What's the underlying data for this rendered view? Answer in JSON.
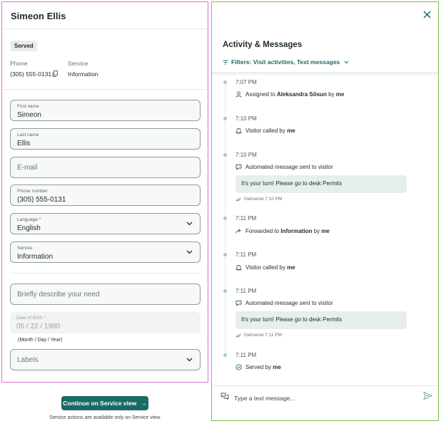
{
  "visitor": {
    "name": "Simeon Ellis",
    "status_badge": "Served",
    "phone_label": "Phone",
    "phone_value": "(305) 555-0131",
    "service_label": "Service",
    "service_value": "Information"
  },
  "form": {
    "first_name": {
      "label": "First name",
      "value": "Simeon"
    },
    "last_name": {
      "label": "Last name",
      "value": "Ellis"
    },
    "email": {
      "placeholder": "E-mail"
    },
    "phone": {
      "label": "Phone number",
      "value": "(305) 555-0131"
    },
    "language": {
      "label": "Language *",
      "value": "English"
    },
    "service": {
      "label": "Service",
      "value": "Information"
    },
    "need": {
      "placeholder": "Briefly describe your need"
    },
    "dob": {
      "label": "Date of Birth *",
      "placeholder": "05 / 22 / 1980",
      "hint": "(Month / Day / Year)"
    },
    "labels": {
      "placeholder": "Labels"
    }
  },
  "footer": {
    "continue_label": "Continue on Service view",
    "continue_arrow": "→",
    "note": "Service actions are available only on Service view."
  },
  "activity": {
    "title": "Activity & Messages",
    "filters_label": "Filters: Visit activities, Text messages",
    "events": [
      {
        "time": "7:07 PM",
        "icon": "user-icon",
        "pre": "Assigned to ",
        "bold": "Aleksandra Sõsun",
        "post": " by ",
        "by": "me"
      },
      {
        "time": "7:10 PM",
        "icon": "bell-icon",
        "pre": "Visitor called by ",
        "bold": "",
        "post": "",
        "by": "me"
      },
      {
        "time": "7:10 PM",
        "icon": "message-icon",
        "pre": "Automated message sent to visitor",
        "bold": "",
        "post": "",
        "by": "",
        "bubble": "It's your turn! Please go to desk Permits",
        "delivered": "Delivered 7:10 PM"
      },
      {
        "time": "7:11 PM",
        "icon": "forward-icon",
        "pre": "Forwarded to ",
        "bold": "Information",
        "post": " by ",
        "by": "me"
      },
      {
        "time": "7:11 PM",
        "icon": "bell-icon",
        "pre": "Visitor called by ",
        "bold": "",
        "post": "",
        "by": "me"
      },
      {
        "time": "7:11 PM",
        "icon": "message-icon",
        "pre": "Automated message sent to visitor",
        "bold": "",
        "post": "",
        "by": "",
        "bubble": "It's your turn! Please go to desk Permits",
        "delivered": "Delivered 7:11 PM"
      },
      {
        "time": "7:11 PM",
        "icon": "check-circle-icon",
        "pre": "Served by ",
        "bold": "",
        "post": "",
        "by": "me"
      }
    ],
    "composer_placeholder": "Type a text message..."
  },
  "colors": {
    "accent": "#1a6b66",
    "left_outline": "#e36be0",
    "right_outline": "#7cc34a"
  }
}
